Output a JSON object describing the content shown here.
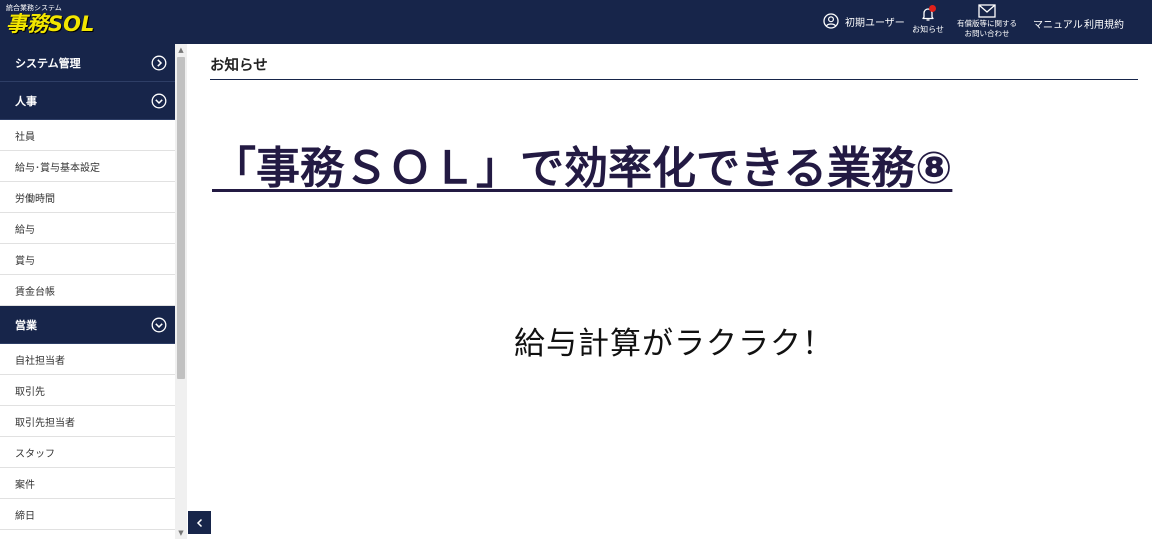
{
  "header": {
    "logo_sub": "統合業務システム",
    "logo_main": "事務SOL",
    "user_label": "初期ユーザー",
    "notice_label": "お知らせ",
    "inquiry_line1": "有償版等に関する",
    "inquiry_line2": "お問い合わせ",
    "manual_label": "マニュアル",
    "terms_label": "利用規約"
  },
  "sidebar": {
    "sections": [
      {
        "label": "システム管理",
        "state": "collapsed"
      },
      {
        "label": "人事",
        "state": "expanded"
      },
      {
        "label": "営業",
        "state": "expanded"
      }
    ],
    "jinji_items": [
      "社員",
      "給与･賞与基本設定",
      "労働時間",
      "給与",
      "賞与",
      "賃金台帳"
    ],
    "eigyo_items": [
      "自社担当者",
      "取引先",
      "取引先担当者",
      "スタッフ",
      "案件",
      "締日"
    ]
  },
  "main": {
    "page_title": "お知らせ",
    "heading": "「事務ＳＯＬ」で効率化できる業務⑧",
    "subtext": "給与計算がラクラク！"
  },
  "colors": {
    "navy": "#17254a",
    "logo_yellow": "#f2e600",
    "badge_red": "#e0201a",
    "heading_color": "#231a43"
  },
  "icons": {
    "user": "user-circle-icon",
    "notice": "bell-icon",
    "inquiry": "mail-icon",
    "collapsed_section": "chevron-right-circle-icon",
    "expanded_section": "chevron-down-circle-icon",
    "collapse_sidebar": "chevron-left-icon"
  }
}
